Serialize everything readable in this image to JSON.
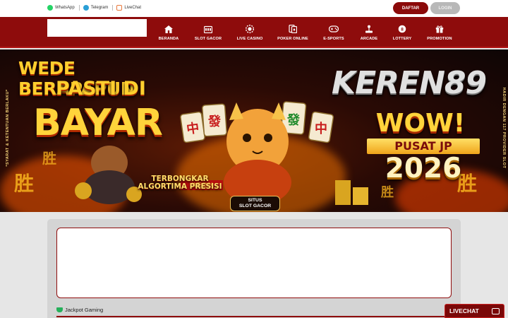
{
  "topbar": {
    "contacts": [
      {
        "label": "WhatsApp",
        "icon": "whatsapp-icon"
      },
      {
        "label": "Telegram",
        "icon": "telegram-icon"
      },
      {
        "label": "LiveChat",
        "icon": "livechat-icon"
      }
    ],
    "daftar_label": "DAFTAR",
    "login_label": "LOGIN"
  },
  "nav": {
    "items": [
      {
        "label": "BERANDA",
        "icon": "home-icon"
      },
      {
        "label": "SLOT GACOR",
        "icon": "slot-icon"
      },
      {
        "label": "LIVE CASINO",
        "icon": "casino-chip-icon"
      },
      {
        "label": "POKER ONLINE",
        "icon": "poker-icon"
      },
      {
        "label": "E-SPORTS",
        "icon": "gamepad-icon"
      },
      {
        "label": "ARCADE",
        "icon": "arcade-icon"
      },
      {
        "label": "LOTTERY",
        "icon": "lottery-icon"
      },
      {
        "label": "PROMOTION",
        "icon": "gift-icon"
      }
    ]
  },
  "banner": {
    "line1": "WEDE BERAPAPUN",
    "line2": "PASTI DI",
    "line3": "BAYAR",
    "brand": "KEREN89",
    "wow": "WOW!",
    "pusat": "PUSAT JP",
    "year": "2026",
    "terbongkar_1": "TERBONGKAR",
    "terbongkar_2": "ALGORTIMA PRESISI",
    "situs_1": "SITUS",
    "situs_2": "SLOT GACOR",
    "side_left": "*SYARAT & KETENTUAN BERLAKU*",
    "side_right": "HADIR DENGAN 117 PROVIDER SLOT"
  },
  "section": {
    "jackpot_label": "Jackpot Gaming"
  },
  "livechat": {
    "label": "LIVECHAT"
  },
  "colors": {
    "brand_red": "#8e0c0c",
    "gold": "#ffd43b"
  }
}
